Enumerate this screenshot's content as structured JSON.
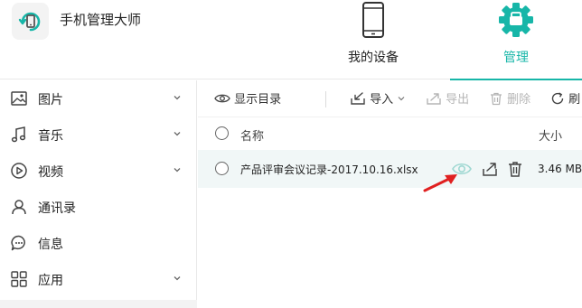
{
  "header": {
    "app_title": "手机管理大师",
    "tabs": [
      {
        "label": "我的设备",
        "icon": "phone-icon",
        "active": false
      },
      {
        "label": "管理",
        "icon": "gear-icon",
        "active": true
      }
    ],
    "accent_color": "#17b6a8"
  },
  "sidebar": {
    "items": [
      {
        "label": "图片",
        "icon": "image-icon",
        "expandable": true
      },
      {
        "label": "音乐",
        "icon": "music-icon",
        "expandable": true
      },
      {
        "label": "视频",
        "icon": "video-icon",
        "expandable": true
      },
      {
        "label": "通讯录",
        "icon": "contacts-icon",
        "expandable": false
      },
      {
        "label": "信息",
        "icon": "message-icon",
        "expandable": false
      },
      {
        "label": "应用",
        "icon": "apps-icon",
        "expandable": true
      }
    ]
  },
  "toolbar": {
    "show_dir_label": "显示目录",
    "import_label": "导入",
    "export_label": "导出",
    "delete_label": "删除",
    "refresh_label": "刷"
  },
  "file_list": {
    "columns": {
      "name": "名称",
      "size": "大小"
    },
    "rows": [
      {
        "name": "产品评审会议记录-2017.10.16.xlsx",
        "size": "3.46 MB"
      }
    ]
  },
  "annotation": {
    "arrow_color": "#e02020"
  }
}
